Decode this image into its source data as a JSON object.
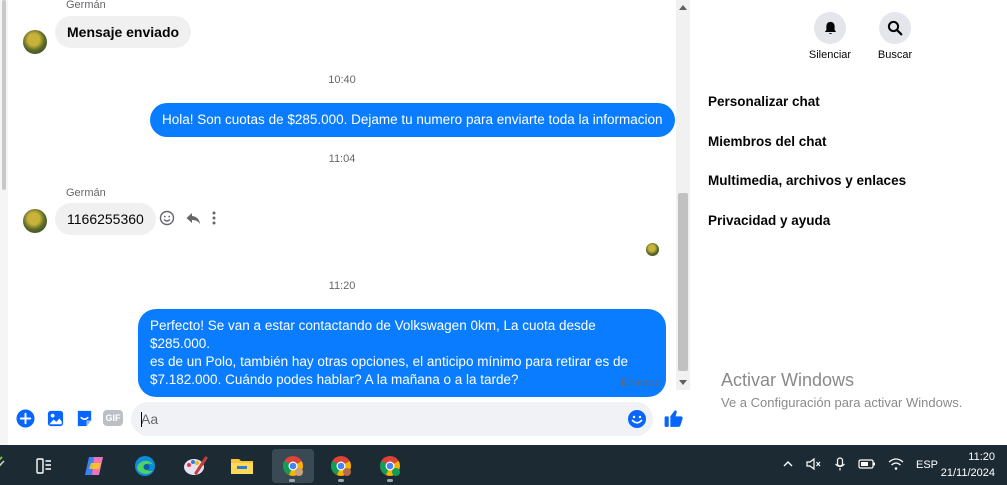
{
  "chat": {
    "messages": [
      {
        "sender": "Germán",
        "text": "Mensaje enviado"
      },
      {
        "time": "10:40"
      },
      {
        "text": "Hola! Son cuotas de $285.000. Dejame tu numero para enviarte toda la informacion"
      },
      {
        "time": "11:04"
      },
      {
        "sender": "Germán",
        "text": "1166255360"
      },
      {
        "time": "11:20"
      },
      {
        "text_lines": [
          "Perfecto!  Se van a estar contactando de Volkswagen 0km, La cuota desde $285.000.",
          "es de un Polo, también hay otras opciones, el anticipo mínimo para retirar es de",
          "$7.182.000. Cuándo podes hablar? A la mañana o a la tarde?"
        ]
      }
    ],
    "status": "Enviado"
  },
  "composer": {
    "placeholder": "Aa",
    "gif_label": "GIF"
  },
  "panel": {
    "mute_label": "Silenciar",
    "search_label": "Buscar",
    "menu": [
      "Personalizar chat",
      "Miembros del chat",
      "Multimedia, archivos y enlaces",
      "Privacidad y ayuda"
    ]
  },
  "watermark": {
    "title": "Activar Windows",
    "subtitle": "Ve a Configuración para activar Windows."
  },
  "taskbar": {
    "language": "ESP",
    "time": "11:20",
    "date": "21/11/2024"
  },
  "colors": {
    "outgoing_bubble": "#0a7cff",
    "incoming_bubble": "#f0f0f0",
    "accent": "#0866ff",
    "taskbar_bg": "#1c2b33"
  }
}
